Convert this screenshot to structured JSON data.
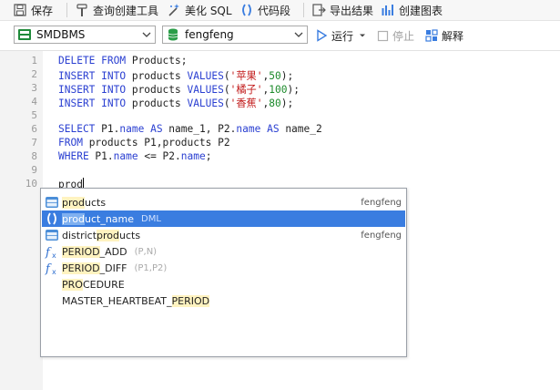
{
  "toolbar": {
    "save": "保存",
    "query_builder": "查询创建工具",
    "beautify": "美化 SQL",
    "snippet": "代码段",
    "export": "导出结果",
    "chart": "创建图表"
  },
  "connection": {
    "server": "SMDBMS",
    "database": "fengfeng",
    "run": "运行",
    "stop": "停止",
    "explain": "解释"
  },
  "editor": {
    "line_numbers": [
      "1",
      "2",
      "3",
      "4",
      "5",
      "6",
      "7",
      "8",
      "9",
      "10"
    ],
    "lines": [
      {
        "parts": [
          {
            "t": "DELETE FROM",
            "c": "kw"
          },
          {
            "t": " Products;",
            "c": ""
          }
        ]
      },
      {
        "parts": [
          {
            "t": "INSERT INTO",
            "c": "kw"
          },
          {
            "t": " products ",
            "c": ""
          },
          {
            "t": "VALUES",
            "c": "kw"
          },
          {
            "t": "(",
            "c": ""
          },
          {
            "t": "'苹果'",
            "c": "str"
          },
          {
            "t": ",",
            "c": ""
          },
          {
            "t": "50",
            "c": "num"
          },
          {
            "t": ");",
            "c": ""
          }
        ]
      },
      {
        "parts": [
          {
            "t": "INSERT INTO",
            "c": "kw"
          },
          {
            "t": " products ",
            "c": ""
          },
          {
            "t": "VALUES",
            "c": "kw"
          },
          {
            "t": "(",
            "c": ""
          },
          {
            "t": "'橘子'",
            "c": "str"
          },
          {
            "t": ",",
            "c": ""
          },
          {
            "t": "100",
            "c": "num"
          },
          {
            "t": ");",
            "c": ""
          }
        ]
      },
      {
        "parts": [
          {
            "t": "INSERT INTO",
            "c": "kw"
          },
          {
            "t": " products ",
            "c": ""
          },
          {
            "t": "VALUES",
            "c": "kw"
          },
          {
            "t": "(",
            "c": ""
          },
          {
            "t": "'香蕉'",
            "c": "str"
          },
          {
            "t": ",",
            "c": ""
          },
          {
            "t": "80",
            "c": "num"
          },
          {
            "t": ");",
            "c": ""
          }
        ]
      },
      {
        "parts": []
      },
      {
        "parts": [
          {
            "t": "SELECT",
            "c": "kw"
          },
          {
            "t": " P1.",
            "c": ""
          },
          {
            "t": "name",
            "c": "kw"
          },
          {
            "t": " ",
            "c": ""
          },
          {
            "t": "AS",
            "c": "kw"
          },
          {
            "t": " name_1, P2.",
            "c": ""
          },
          {
            "t": "name",
            "c": "kw"
          },
          {
            "t": " ",
            "c": ""
          },
          {
            "t": "AS",
            "c": "kw"
          },
          {
            "t": " name_2",
            "c": ""
          }
        ]
      },
      {
        "parts": [
          {
            "t": "FROM",
            "c": "kw"
          },
          {
            "t": " products P1,products P2",
            "c": ""
          }
        ]
      },
      {
        "parts": [
          {
            "t": "WHERE",
            "c": "kw"
          },
          {
            "t": " P1.",
            "c": ""
          },
          {
            "t": "name",
            "c": "kw"
          },
          {
            "t": " <= P2.",
            "c": ""
          },
          {
            "t": "name",
            "c": "kw"
          },
          {
            "t": ";",
            "c": ""
          }
        ]
      },
      {
        "parts": []
      },
      {
        "parts": [
          {
            "t": "prod",
            "c": ""
          }
        ],
        "caret": true
      }
    ]
  },
  "autocomplete": {
    "items": [
      {
        "pre": "",
        "match": "prod",
        "post": "ucts",
        "extra": "",
        "owner": "fengfeng",
        "icon": "table-icon",
        "selected": false
      },
      {
        "pre": "",
        "match": "prod",
        "post": "uct_name",
        "extra": "DML",
        "owner": "",
        "icon": "snippet-icon",
        "selected": true
      },
      {
        "pre": "district",
        "match": "prod",
        "post": "ucts",
        "extra": "",
        "owner": "fengfeng",
        "icon": "table-icon",
        "selected": false
      },
      {
        "pre": "",
        "match": "PERIOD",
        "post": "_ADD",
        "extra": "(P,N)",
        "owner": "",
        "icon": "function-icon",
        "selected": false
      },
      {
        "pre": "",
        "match": "PERIOD",
        "post": "_DIFF",
        "extra": "(P1,P2)",
        "owner": "",
        "icon": "function-icon",
        "selected": false
      },
      {
        "pre": "",
        "match": "PRO",
        "post": "CEDURE",
        "extra": "",
        "owner": "",
        "icon": "",
        "selected": false
      },
      {
        "pre": "MASTER_HEARTBEAT_",
        "match": "PERIOD",
        "post": "",
        "extra": "",
        "owner": "",
        "icon": "",
        "selected": false
      }
    ]
  }
}
